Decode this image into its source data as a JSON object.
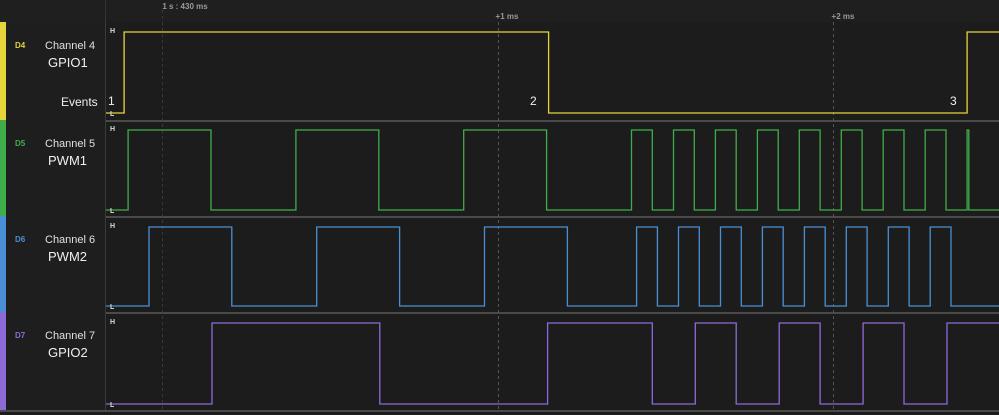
{
  "ruler": {
    "markers": [
      {
        "label": "1 s : 430 ms",
        "t": 0
      },
      {
        "label": "+1 ms",
        "t": 1000
      },
      {
        "label": "+2 ms",
        "t": 2000
      }
    ]
  },
  "time_unit": "us relative to 1 s : 430 ms",
  "view": {
    "start": -167,
    "end": 2494
  },
  "level_labels": {
    "high": "H",
    "low": "L"
  },
  "channels": [
    {
      "id": "D4",
      "name": "Channel 4",
      "label": "GPIO1",
      "color": "#e5d43a",
      "initial": 0,
      "edges": [
        -113,
        1152,
        2399
      ],
      "events_label": "Events",
      "events": [
        {
          "num": "1",
          "t": -150
        },
        {
          "num": "2",
          "t": 1107
        },
        {
          "num": "3",
          "t": 2350
        }
      ]
    },
    {
      "id": "D5",
      "name": "Channel 5",
      "label": "PWM1",
      "color": "#3fae4a",
      "initial": 0,
      "edges": [
        -101,
        146,
        399,
        646,
        899,
        1146,
        1399,
        1461,
        1524,
        1586,
        1649,
        1711,
        1774,
        1836,
        1899,
        1961,
        2024,
        2086,
        2149,
        2211,
        2274,
        2336,
        2399,
        2404
      ]
    },
    {
      "id": "D6",
      "name": "Channel 6",
      "label": "PWM2",
      "color": "#4a8fd6",
      "initial": 0,
      "edges": [
        -39,
        208,
        461,
        708,
        961,
        1208,
        1414,
        1476,
        1539,
        1601,
        1664,
        1726,
        1789,
        1851,
        1914,
        1976,
        2039,
        2101,
        2164,
        2226,
        2289,
        2351
      ]
    },
    {
      "id": "D7",
      "name": "Channel 7",
      "label": "GPIO2",
      "color": "#8e6ad8",
      "initial": 0,
      "edges": [
        149,
        649,
        1149,
        1461,
        1589,
        1711,
        1839,
        1961,
        2089,
        2211,
        2339
      ]
    }
  ]
}
